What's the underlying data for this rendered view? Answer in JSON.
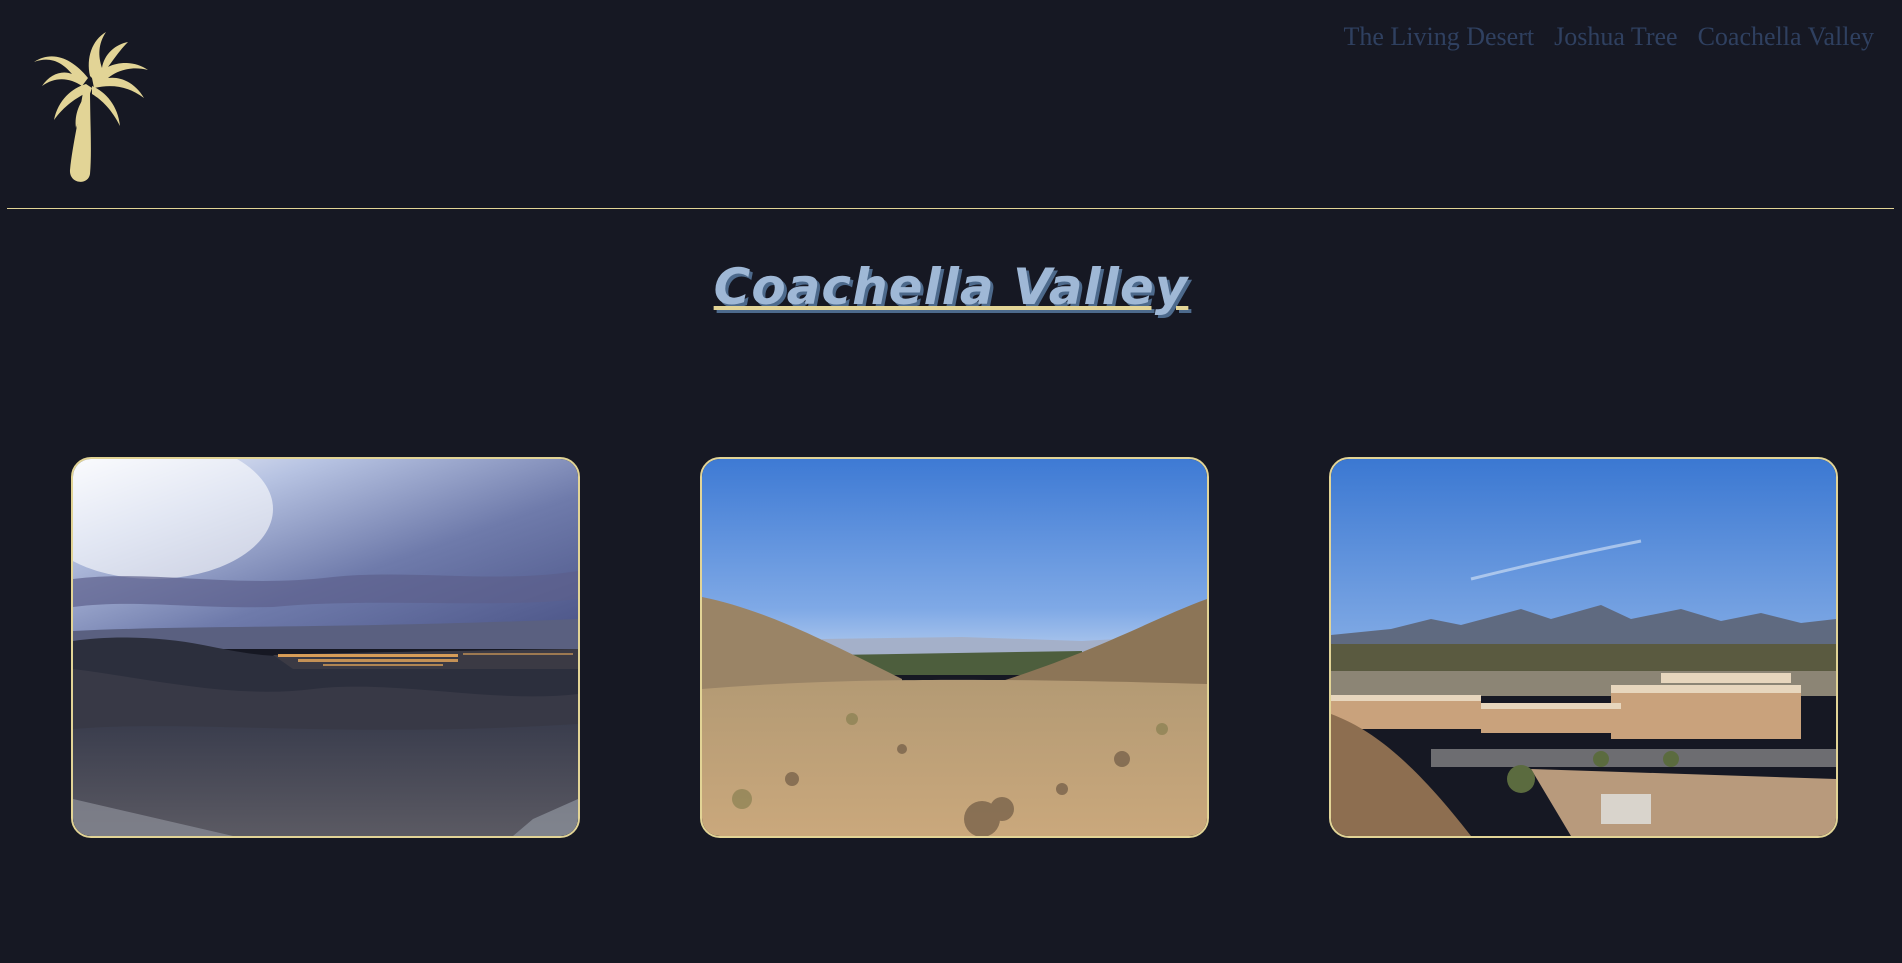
{
  "logo": {
    "icon": "palm-tree-icon",
    "color": "#e2d496"
  },
  "nav": {
    "items": [
      {
        "label": "The Living Desert"
      },
      {
        "label": "Joshua Tree"
      },
      {
        "label": "Coachella Valley"
      }
    ],
    "color": "#2f4060"
  },
  "page": {
    "title": "Coachella Valley"
  },
  "gallery": {
    "photos": [
      {
        "subject": "dusk-valley-lights-photo"
      },
      {
        "subject": "desert-canyon-photo"
      },
      {
        "subject": "shopping-center-mountains-photo"
      }
    ],
    "border_color": "#e2d496"
  },
  "colors": {
    "background": "#161823",
    "accent": "#e2d496",
    "title": "#9fb8d6"
  }
}
